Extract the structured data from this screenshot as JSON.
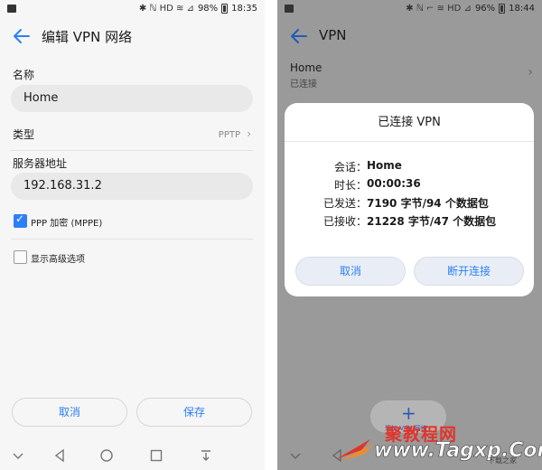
{
  "left": {
    "status": {
      "icons": "✱ ℕ HD ≋ ⊿",
      "battery": "98%",
      "time": "18:35"
    },
    "title": "编辑 VPN 网络",
    "name_label": "名称",
    "name_value": "Home",
    "type_label": "类型",
    "type_value": "PPTP",
    "server_label": "服务器地址",
    "server_value": "192.168.31.2",
    "ppp_label": "PPP 加密 (MPPE)",
    "advanced_label": "显示高级选项",
    "cancel": "取消",
    "save": "保存"
  },
  "right": {
    "status": {
      "icons": "✱ ℕ ⌐ ≋ HD ⊿",
      "battery": "96%",
      "time": "18:44"
    },
    "title": "VPN",
    "vpn_name": "Home",
    "vpn_status": "已连接",
    "dialog": {
      "title": "已连接 VPN",
      "rows": [
        {
          "k": "会话：",
          "v": "Home"
        },
        {
          "k": "时长：",
          "v": "00:00:36"
        },
        {
          "k": "已发送：",
          "v": "7190 字节/94 个数据包"
        },
        {
          "k": "已接收：",
          "v": "21228 字节/47 个数据包"
        }
      ],
      "cancel": "取消",
      "disconnect": "断开连接"
    },
    "fab_label": "添加 VPN 网络",
    "watermark_top": "聚教程网",
    "watermark_url": "www.Tagxp.Com",
    "watermark_side": "下载之家"
  },
  "colors": {
    "accent": "#2d7ff5",
    "dim_bg": "#9a9a9a",
    "watermark_red": "#e0352b"
  }
}
